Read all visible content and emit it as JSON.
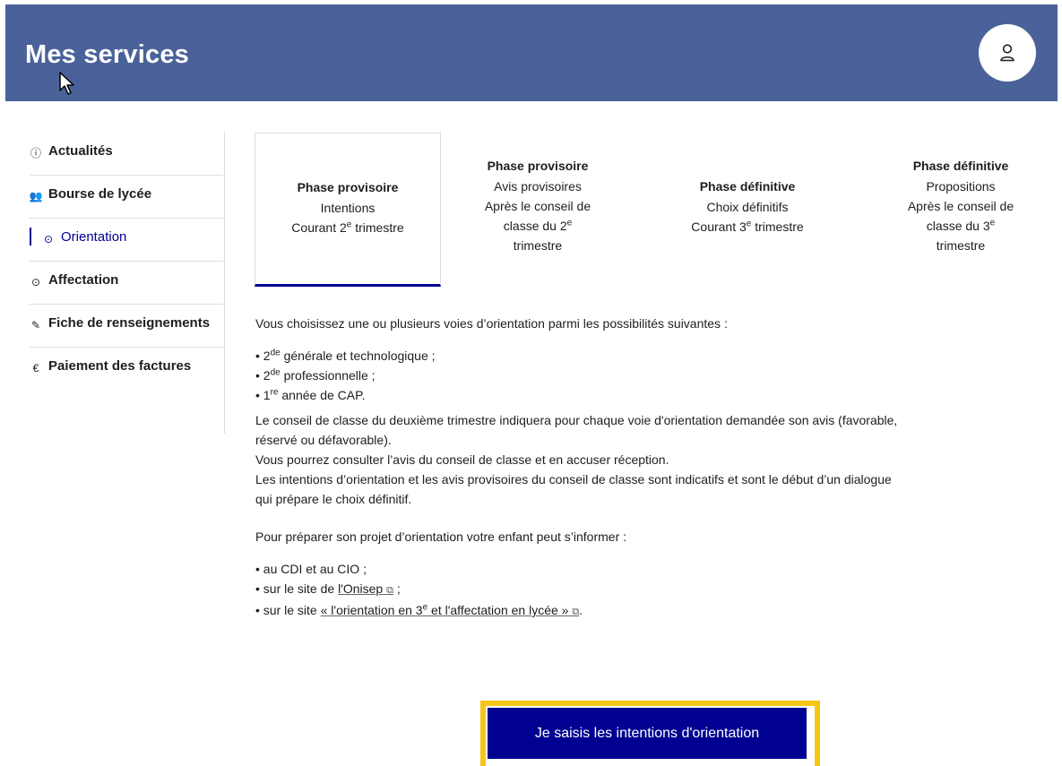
{
  "header": {
    "title": "Mes services",
    "background": "#4a6199"
  },
  "sidebar": {
    "items": [
      {
        "label": "Actualités",
        "icon": "info-icon"
      },
      {
        "label": "Bourse de lycée",
        "icon": "people-icon"
      },
      {
        "label": "Orientation",
        "icon": "compass-icon",
        "active": true
      },
      {
        "label": "Affectation",
        "icon": "compass-icon"
      },
      {
        "label": "Fiche de renseignements",
        "icon": "edit-icon"
      },
      {
        "label": "Paiement des factures",
        "icon": "euro-icon"
      }
    ]
  },
  "tabs": [
    {
      "title": "Phase provisoire",
      "line1": "Intentions",
      "line2_pre": "Courant 2",
      "line2_sup": "e",
      "line2_post": " trimestre",
      "active": true
    },
    {
      "title": "Phase provisoire",
      "line1": "Avis provisoires",
      "line2": "Après le conseil de",
      "line3_pre": "classe du 2",
      "line3_sup": "e",
      "line4": "trimestre"
    },
    {
      "title": "Phase définitive",
      "line1": "Choix définitifs",
      "line2_pre": "Courant 3",
      "line2_sup": "e",
      "line2_post": " trimestre"
    },
    {
      "title": "Phase définitive",
      "line1": "Propositions",
      "line2": "Après le conseil de",
      "line3_pre": "classe du 3",
      "line3_sup": "e",
      "line4": "trimestre"
    }
  ],
  "content": {
    "intro": "Vous choisissez une ou plusieurs voies d’orientation parmi les possibilités suivantes :",
    "voies": [
      {
        "pre": "2",
        "sup": "de",
        "post": " générale et technologique ;"
      },
      {
        "pre": "2",
        "sup": "de",
        "post": " professionnelle ;"
      },
      {
        "pre": "1",
        "sup": "re",
        "post": " année de CAP."
      }
    ],
    "para_lines": [
      "Le conseil de classe du deuxième trimestre indiquera pour chaque voie d'orientation demandée son avis (favorable,",
      "réservé ou défavorable).",
      "Vous pourrez consulter l’avis du conseil de classe et en accuser réception.",
      "Les intentions d’orientation et les avis provisoires du conseil de classe sont indicatifs et sont le début d’un dialogue",
      "qui prépare le choix définitif."
    ],
    "inform": "Pour préparer son projet d’orientation votre enfant peut s’informer :",
    "info1": "au CDI et au CIO ;",
    "info2_pre": "sur le site de ",
    "info2_link": "l'Onisep",
    "info2_post": " ;",
    "info3_pre": "sur le site ",
    "info3_link_pre": "« l'orientation en 3",
    "info3_link_sup": "e",
    "info3_link_post": " et l'affectation en lycée »",
    "info3_post": "."
  },
  "cta": {
    "label": "Je saisis les intentions d'orientation"
  },
  "colors": {
    "primary": "#000091",
    "highlight": "#f5c518"
  }
}
